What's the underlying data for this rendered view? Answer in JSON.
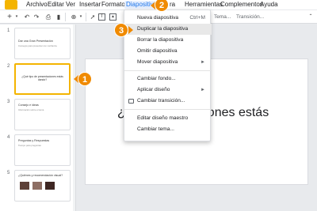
{
  "menubar": {
    "items": [
      "Archivo",
      "Editar",
      "Ver",
      "Insertar",
      "Formato",
      "Diapositiva",
      "Organizar",
      "Herramientas",
      "Complementos",
      "Ayuda"
    ],
    "visible_partial": "ra"
  },
  "toolbar": {
    "add_label": "+",
    "zoom_label": "⊕",
    "tema_label": "Tema...",
    "transicion_label": "Transición..."
  },
  "slide_menu": {
    "items": [
      {
        "label": "Nueva diapositiva",
        "shortcut": "Ctrl+M"
      },
      {
        "label": "Duplicar la diapositiva"
      },
      {
        "label": "Borrar la diapositiva"
      },
      {
        "label": "Omitir diapositiva"
      },
      {
        "label": "Mover diapositiva",
        "submenu": "►"
      },
      {
        "label": "Cambiar fondo..."
      },
      {
        "label": "Aplicar diseño",
        "submenu": "►"
      },
      {
        "label": "Cambiar transición..."
      },
      {
        "label": "Editar diseño maestro"
      },
      {
        "label": "Cambiar tema..."
      }
    ]
  },
  "slides": [
    {
      "num": "1",
      "title": "Dar una Gran Presentación",
      "subtitle": "Consejos para presentar con confianza"
    },
    {
      "num": "2",
      "title": "¿Qué tipo de presentaciones estás dando?"
    },
    {
      "num": "3",
      "title": "Consejo e ideas",
      "subtitle": "Información sobre el tema"
    },
    {
      "num": "4",
      "title": "Preguntas y Respuestas",
      "subtitle": "Tiempo para preguntas"
    },
    {
      "num": "5",
      "title": "¿Quiénes y recomendación visual?"
    }
  ],
  "canvas": {
    "line1": "¿Q             ntaciones estás",
    "line2": "?"
  },
  "callouts": [
    "1",
    "2",
    "3"
  ],
  "colors": {
    "accent": "#f08a00",
    "selection": "#f4b400",
    "menu_active": "#1a73e8"
  }
}
